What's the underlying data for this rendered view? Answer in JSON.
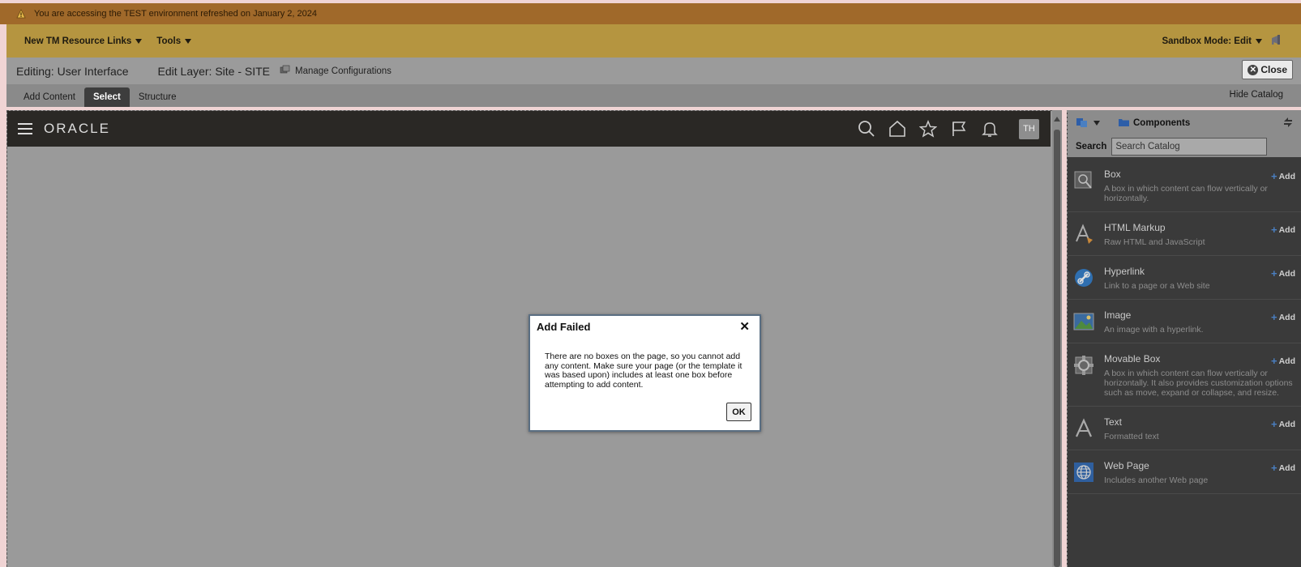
{
  "banner": {
    "text": "You are accessing the TEST environment refreshed on January 2, 2024",
    "icon": "warning-icon"
  },
  "toolbar": {
    "resource_links": "New TM Resource Links",
    "tools": "Tools",
    "sandbox_mode": "Sandbox Mode: Edit"
  },
  "editbar": {
    "editing": "Editing: User Interface",
    "layer": "Edit Layer: Site - SITE",
    "manage": "Manage Configurations",
    "close": "Close"
  },
  "tabs": [
    {
      "label": "Add Content",
      "active": false
    },
    {
      "label": "Select",
      "active": true
    },
    {
      "label": "Structure",
      "active": false
    }
  ],
  "hide_catalog": "Hide Catalog",
  "app_header": {
    "logo": "ORACLE",
    "icons": [
      "search-icon",
      "home-icon",
      "star-icon",
      "flag-icon",
      "bell-icon"
    ],
    "avatar": "TH"
  },
  "catalog": {
    "folder": "Components",
    "search_label": "Search",
    "search_placeholder": "Search Catalog",
    "add_label": "Add",
    "items": [
      {
        "name": "Box",
        "desc": "A box in which content can flow vertically or horizontally.",
        "icon": "box-icon"
      },
      {
        "name": "HTML Markup",
        "desc": "Raw HTML and JavaScript",
        "icon": "html-markup-icon"
      },
      {
        "name": "Hyperlink",
        "desc": "Link to a page or a Web site",
        "icon": "hyperlink-icon"
      },
      {
        "name": "Image",
        "desc": "An image with a hyperlink.",
        "icon": "image-icon"
      },
      {
        "name": "Movable Box",
        "desc": "A box in which content can flow vertically or horizontally. It also provides customization options such as move, expand or collapse, and resize.",
        "icon": "movable-box-icon"
      },
      {
        "name": "Text",
        "desc": "Formatted text",
        "icon": "text-icon"
      },
      {
        "name": "Web Page",
        "desc": "Includes another Web page",
        "icon": "web-page-icon"
      }
    ]
  },
  "dialog": {
    "title": "Add Failed",
    "message": "There are no boxes on the page, so you cannot add any content. Make sure your page (or the template it was based upon) includes at least one box before attempting to add content.",
    "ok": "OK"
  }
}
